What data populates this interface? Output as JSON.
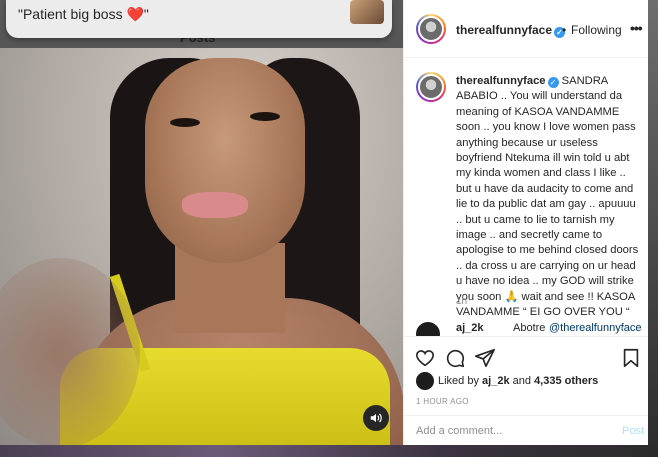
{
  "notification": {
    "text": "\"Patient big boss",
    "heart": "❤️",
    "close_quote": "\""
  },
  "background": {
    "section_label": "Posts"
  },
  "post": {
    "header": {
      "username": "therealfunnyface",
      "separator": "•",
      "follow_status": "Following",
      "more_icon": "more-horizontal-icon"
    },
    "caption": {
      "username": "therealfunnyface",
      "text": "SANDRA ABABIO .. You will understand da meaning of KASOA VANDAMME soon .. you know I love women pass anything because ur useless boyfriend Ntekuma ill win told u abt my kinda women and class I like .. but u have da audacity to come and lie to da public dat am gay .. apuuuu .. but u came to lie to tarnish my image .. and secretly came to apologise to me behind closed doors .. da cross u are carrying on ur head u have no idea .. my GOD will strike you soon 🙏 wait and see !! KASOA VANDAMME “ EI GO OVER YOU “",
      "time": "1h"
    },
    "comment": {
      "username": "aj_2k",
      "text": "Abotre",
      "mention": "@therealfunnyface"
    },
    "likes": {
      "prefix": "Liked by",
      "user": "aj_2k",
      "joiner": "and",
      "others": "4,335 others"
    },
    "timestamp": "1 HOUR AGO",
    "add_comment": {
      "placeholder": "Add a comment...",
      "post_label": "Post"
    },
    "media": {
      "sound_icon": "volume-icon"
    }
  },
  "colors": {
    "verified": "#3897f0",
    "link": "#00376b",
    "muted": "#8e8e8e",
    "post_button": "#b2dffc"
  }
}
